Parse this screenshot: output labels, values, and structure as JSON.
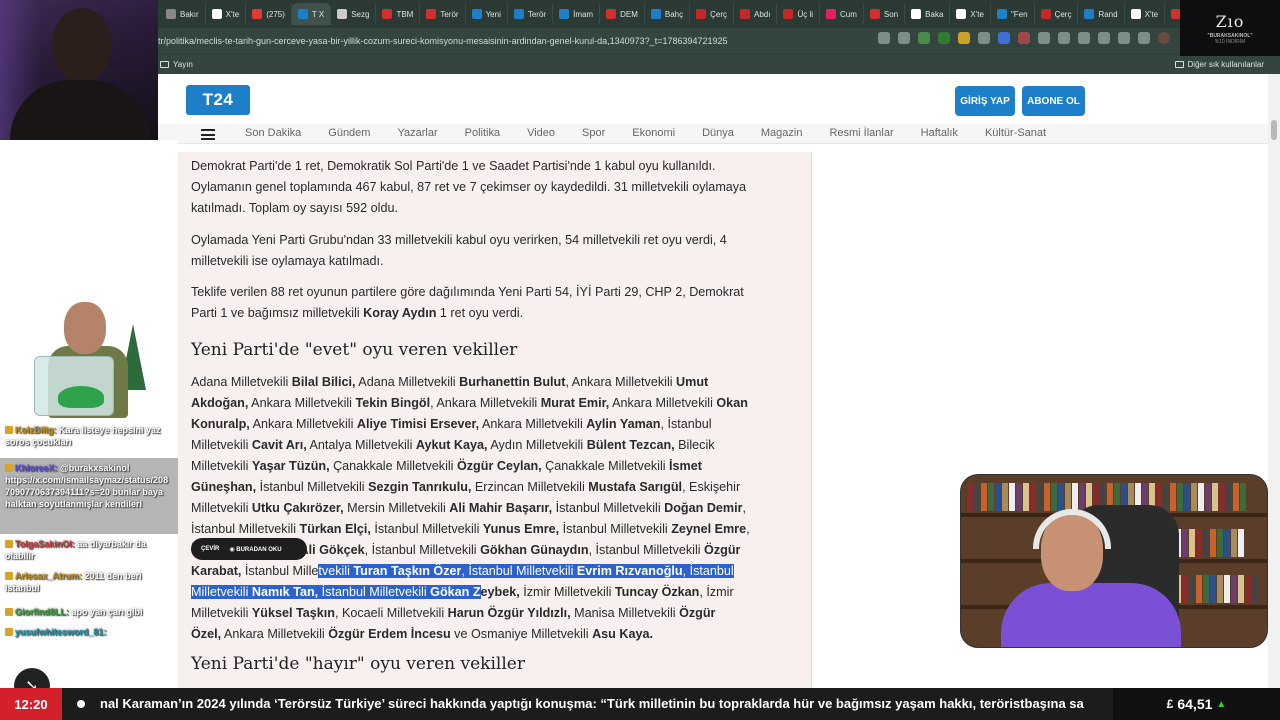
{
  "browser": {
    "tabs": [
      {
        "label": "Bakır",
        "color": "#888888"
      },
      {
        "label": "X'te",
        "color": "#ffffff"
      },
      {
        "label": "(275)",
        "color": "#e53935"
      },
      {
        "label": "T X",
        "color": "#1c7fc7",
        "active": true
      },
      {
        "label": "Sezg",
        "color": "#cccccc"
      },
      {
        "label": "TBM",
        "color": "#d32f2f"
      },
      {
        "label": "Terör",
        "color": "#d32f2f"
      },
      {
        "label": "Yeni",
        "color": "#1c7fc7"
      },
      {
        "label": "Terör",
        "color": "#1c7fc7"
      },
      {
        "label": "İmam",
        "color": "#1c7fc7"
      },
      {
        "label": "DEM",
        "color": "#d32f2f"
      },
      {
        "label": "Bahç",
        "color": "#1c7fc7"
      },
      {
        "label": "Çerç",
        "color": "#c62828"
      },
      {
        "label": "Abdı",
        "color": "#c62828"
      },
      {
        "label": "Üç li",
        "color": "#c62828"
      },
      {
        "label": "Cum",
        "color": "#e91e63"
      },
      {
        "label": "Son",
        "color": "#d32f2f"
      },
      {
        "label": "Baka",
        "color": "#ffffff"
      },
      {
        "label": "X'te",
        "color": "#ffffff"
      },
      {
        "label": "\"Fen",
        "color": "#1c7fc7"
      },
      {
        "label": "Çerç",
        "color": "#c62828"
      },
      {
        "label": "Rand",
        "color": "#1c7fc7"
      },
      {
        "label": "X'te",
        "color": "#ffffff"
      },
      {
        "label": "Kulis",
        "color": "#d32f2f"
      },
      {
        "label": "Akar",
        "color": "#d32f2f"
      }
    ],
    "new_tab": "+",
    "url": "tr/politika/meclis-te-tarih-gun-cerceve-yasa-bir-yillik-cozum-sureci-komisyonu-mesaisinin-ardindan-genel-kurul-da,1340973?_t=1786394721925",
    "bookmark_left": "Yayın",
    "bookmark_right": "Diğer sık kullanılanlar"
  },
  "site": {
    "logo": "T24",
    "login": "GİRİŞ YAP",
    "subscribe": "ABONE OL",
    "nav": [
      "Son Dakika",
      "Gündem",
      "Yazarlar",
      "Politika",
      "Video",
      "Spor",
      "Ekonomi",
      "Dünya",
      "Magazin",
      "Resmi İlanlar",
      "Haftalık",
      "Kültür-Sanat"
    ]
  },
  "article": {
    "p1_l1": "Demokrat Parti'de 1 ret, Demokratik Sol Parti'de 1 ve Saadet Partisi'nde 1 kabul oyu kullanıldı.",
    "p1_l2": "Oylamanın genel toplamında 467 kabul, 87 ret ve 7 çekimser oy kaydedildi. 31 milletvekili oylamaya",
    "p1_l3": "katılmadı. Toplam oy sayısı 592 oldu.",
    "p2_l1": "Oylamada Yeni Parti Grubu'ndan 33 milletvekili kabul oyu verirken, 54 milletvekili ret oyu verdi, 4",
    "p2_l2": "milletvekili ise oylamaya katılmadı.",
    "p3_l1": "Teklife verilen 88 ret oyunun partilere göre dağılımında Yeni Parti 54, İYİ Parti 29, CHP 2, Demokrat",
    "p3_l2a": "Parti 1 ve bağımsız milletvekili ",
    "p3_l2b": "Koray Aydın",
    "p3_l2c": " 1 ret oyu verdi.",
    "h_evet": "Yeni Parti'de \"evet\" oyu veren vekiller",
    "h_hayir": "Yeni Parti'de \"hayır\" oyu veren vekiller",
    "popup_translate": "ÇEVİR",
    "popup_read": "BURADAN OKU"
  },
  "list_lines": [
    [
      [
        "Adana Milletvekili ",
        0
      ],
      [
        "Bilal Bilici,",
        1
      ],
      [
        " Adana Milletvekili ",
        0
      ],
      [
        "Burhanettin Bulut",
        1
      ],
      [
        ", Ankara Milletvekili ",
        0
      ],
      [
        "Umut",
        1
      ]
    ],
    [
      [
        "Akdoğan,",
        1
      ],
      [
        " Ankara Milletvekili ",
        0
      ],
      [
        "Tekin Bingöl",
        1
      ],
      [
        ", Ankara Milletvekili ",
        0
      ],
      [
        "Murat Emir,",
        1
      ],
      [
        " Ankara Milletvekili ",
        0
      ],
      [
        "Okan",
        1
      ]
    ],
    [
      [
        "Konuralp,",
        1
      ],
      [
        "  Ankara Milletvekili ",
        0
      ],
      [
        "Aliye Timisi Ersever,",
        1
      ],
      [
        "  Ankara Milletvekili ",
        0
      ],
      [
        "Aylin Yaman",
        1
      ],
      [
        ", İstanbul",
        0
      ]
    ],
    [
      [
        "Milletvekili ",
        0
      ],
      [
        "Cavit Arı,",
        1
      ],
      [
        " Antalya Milletvekili ",
        0
      ],
      [
        "Aykut Kaya,",
        1
      ],
      [
        " Aydın Milletvekili ",
        0
      ],
      [
        "Bülent Tezcan,",
        1
      ],
      [
        " Bilecik",
        0
      ]
    ],
    [
      [
        "Milletvekili ",
        0
      ],
      [
        "Yaşar Tüzün,",
        1
      ],
      [
        " Çanakkale Milletvekili ",
        0
      ],
      [
        "Özgür Ceylan,",
        1
      ],
      [
        " Çanakkale Milletvekili ",
        0
      ],
      [
        "İsmet",
        1
      ]
    ],
    [
      [
        "Güneşhan,",
        1
      ],
      [
        " İstanbul Milletvekili ",
        0
      ],
      [
        "Sezgin Tanrıkulu,",
        1
      ],
      [
        " Erzincan Milletvekili ",
        0
      ],
      [
        "Mustafa Sarıgül",
        1
      ],
      [
        ", Eskişehir",
        0
      ]
    ],
    [
      [
        "Milletvekili ",
        0
      ],
      [
        "Utku Çakırözer,",
        1
      ],
      [
        " Mersin Milletvekili ",
        0
      ],
      [
        "Ali Mahir Başarır,",
        1
      ],
      [
        " İstanbul Milletvekili ",
        0
      ],
      [
        "Doğan Demir",
        1
      ],
      [
        ",",
        0
      ]
    ],
    [
      [
        "İstanbul Milletvekili ",
        0
      ],
      [
        "Türkan Elçi,",
        1
      ],
      [
        " İstanbul Milletvekili ",
        0
      ],
      [
        "Yunus Emre,",
        1
      ],
      [
        " İstanbul Milletvekili ",
        0
      ],
      [
        "Zeynel Emre",
        1
      ],
      [
        ",",
        0
      ]
    ],
    [
      [
        "İstanbul Milletvekili ",
        0
      ],
      [
        "Ali Gökçek",
        1
      ],
      [
        ", İstanbul Milletvekili ",
        0
      ],
      [
        "Gökhan Günaydın",
        1
      ],
      [
        ", İstanbul Milletvekili ",
        0
      ],
      [
        "Özgür",
        1
      ]
    ],
    [
      [
        "Karabat,",
        1
      ],
      [
        " İstanbul Mille",
        0
      ],
      [
        "tvekili ",
        2
      ],
      [
        "Turan Taşkın Özer",
        3
      ],
      [
        ", İstanbul Milletvekili ",
        2
      ],
      [
        "Evrim Rızvanoğlu",
        3
      ],
      [
        ", İstanbul",
        2
      ]
    ],
    [
      [
        "Milletvekili ",
        2
      ],
      [
        "Namık Tan,",
        3
      ],
      [
        " İstanbul Milletvekili ",
        2
      ],
      [
        "Gökan Z",
        3
      ],
      [
        "eybek,",
        1
      ],
      [
        " İzmir Milletvekili ",
        0
      ],
      [
        "Tuncay Özkan",
        1
      ],
      [
        ", İzmir",
        0
      ]
    ],
    [
      [
        "Milletvekili ",
        0
      ],
      [
        "Yüksel Taşkın",
        1
      ],
      [
        ", Kocaeli Milletvekili ",
        0
      ],
      [
        "Harun Özgür Yıldızlı,",
        1
      ],
      [
        " Manisa Milletvekili ",
        0
      ],
      [
        "Özgür",
        1
      ]
    ],
    [
      [
        "Özel,",
        1
      ],
      [
        " Ankara Milletvekili ",
        0
      ],
      [
        "Özgür Erdem İncesu",
        1
      ],
      [
        " ve Osmaniye Milletvekili ",
        0
      ],
      [
        "Asu Kaya.",
        1
      ]
    ]
  ],
  "chat": {
    "messages": [
      {
        "user": "KolzBilig:",
        "text": "Kara listeye hepsini yaz soros çocukları",
        "cls": "gold"
      },
      {
        "user": "KhloreeX:",
        "text": "@burakxsakinol https://x.com/ismailsaymaz/status/2087090770637394111?s=20 bunlar baya halktan soyutlanmışlar kendileri",
        "cls": "purple"
      },
      {
        "user": "TolgaSakinOl:",
        "text": "aa diyarbakır da olabilir",
        "cls": "red"
      },
      {
        "user": "Arlesax_Atrum:",
        "text": "2011 den beri istanbul",
        "cls": "gold"
      },
      {
        "user": "Giorfind8LL:",
        "text": "apo yan çarı gibi",
        "cls": "green"
      },
      {
        "user": "yusufwhitesword_81:",
        "text": "",
        "cls": "teal"
      }
    ]
  },
  "stream": {
    "brand": "Zıo",
    "brand_line1": "\"BURAKSAKINOL\"",
    "brand_line2": "%10 İNDİRİM",
    "time": "12:20",
    "ticker": "nal Karaman’ın 2024 yılında ‘Terörsüz Türkiye’ süreci hakkında yaptığı konuşma: “Türk milletinin bu topraklarda hür ve bağımsız yaşam hakkı, teröristbaşına sa",
    "currency": "£",
    "price": "64,51",
    "trend": "▲"
  }
}
